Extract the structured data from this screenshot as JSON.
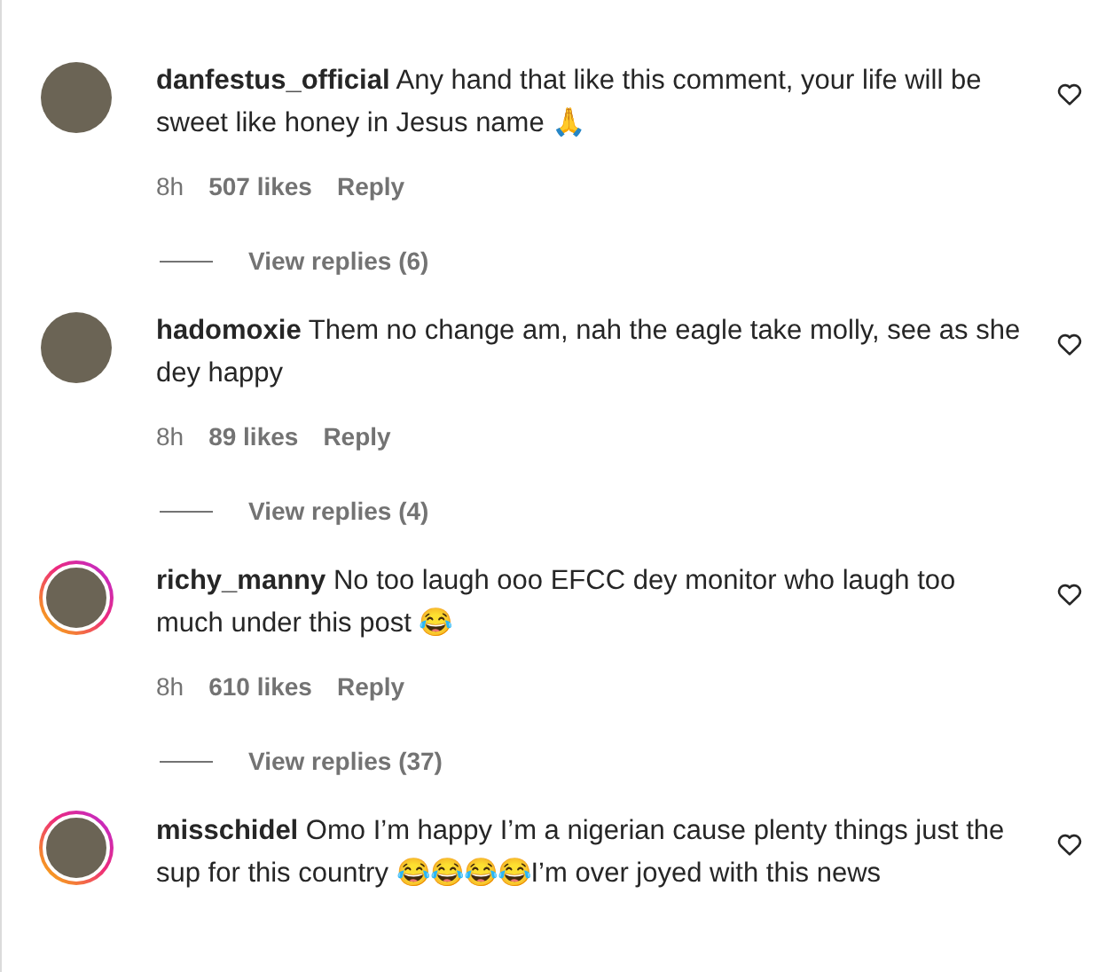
{
  "comments": [
    {
      "username": "danfestus_official",
      "text": "Any hand that like this comment, your life will be sweet like honey in Jesus name 🙏",
      "story": false,
      "time": "8h",
      "likes": "507 likes",
      "reply": "Reply",
      "view_replies": "View replies (6)"
    },
    {
      "username": "hadomoxie",
      "text": "Them no change am, nah the eagle take molly, see as she dey happy",
      "story": false,
      "time": "8h",
      "likes": "89 likes",
      "reply": "Reply",
      "view_replies": "View replies (4)"
    },
    {
      "username": "richy_manny",
      "text": "No too laugh ooo EFCC dey monitor who laugh too much under this post 😂",
      "story": true,
      "time": "8h",
      "likes": "610 likes",
      "reply": "Reply",
      "view_replies": "View replies (37)"
    },
    {
      "username": "misschidel",
      "text": "Omo I’m happy I’m a nigerian cause plenty things just the sup for this country 😂😂😂😂I’m over joyed with this news",
      "story": true
    }
  ]
}
